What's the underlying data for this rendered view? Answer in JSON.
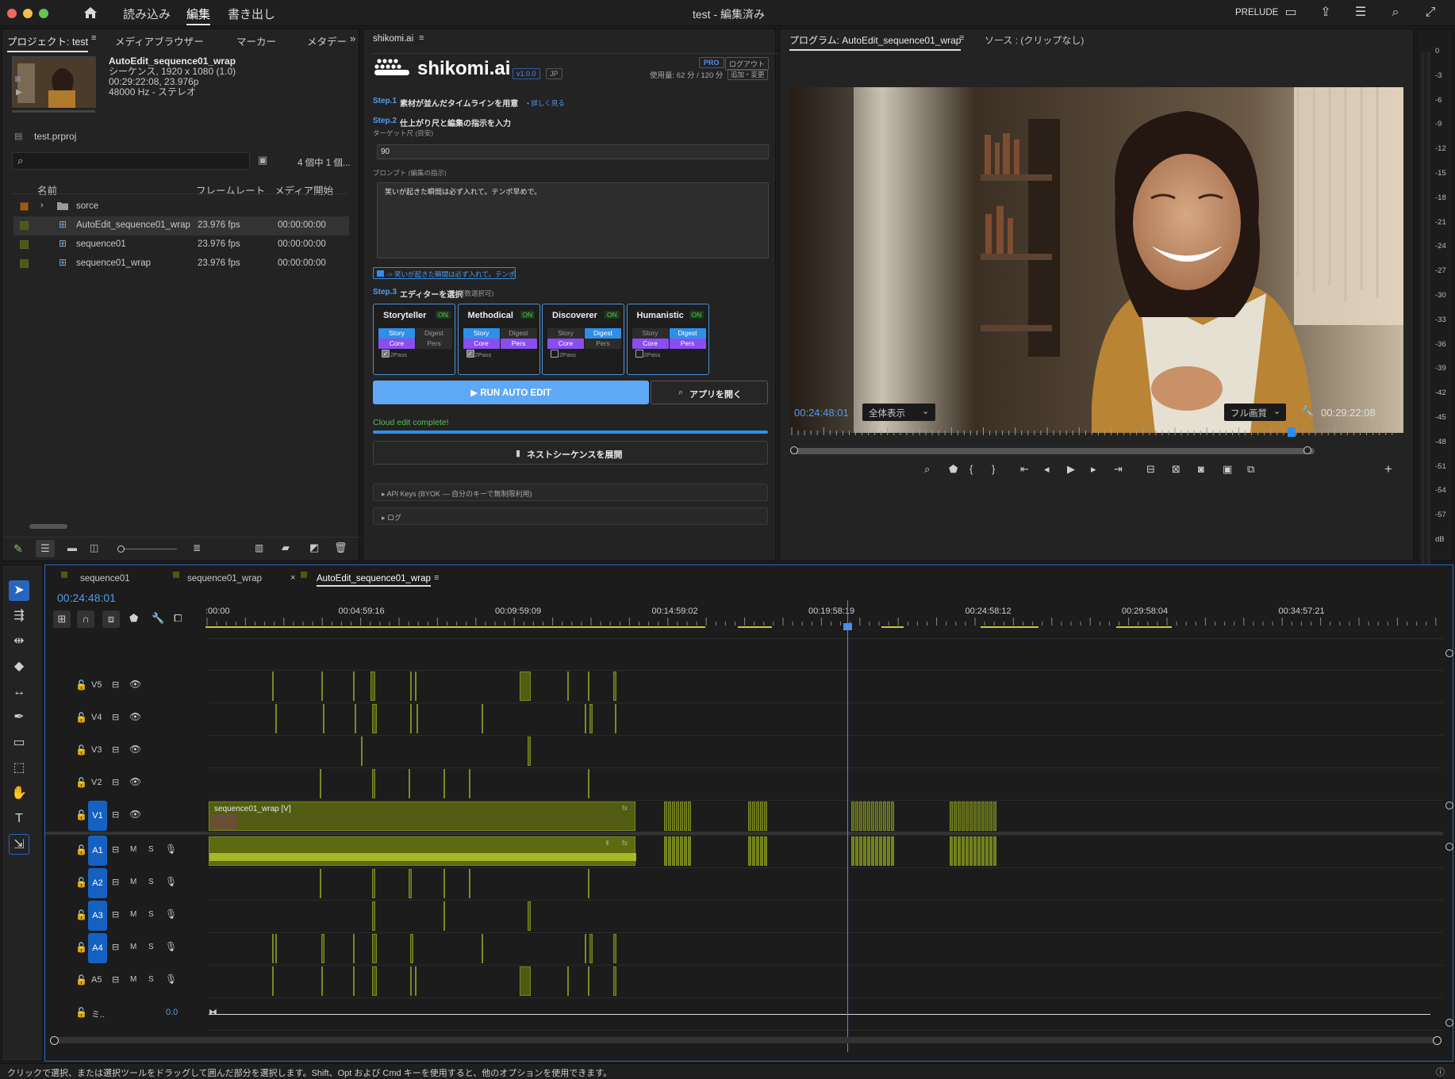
{
  "window": {
    "title": "test - 編集済み",
    "nav": [
      "読み込み",
      "編集",
      "書き出し"
    ],
    "active_nav": "編集",
    "prelude_label": "PRELUDE"
  },
  "project_panel": {
    "tabs": [
      "プロジェクト: test",
      "メディアブラウザー",
      "マーカー",
      "メタデー"
    ],
    "clip_name": "AutoEdit_sequence01_wrap",
    "clip_info": [
      "シーケンス, 1920 x 1080 (1.0)",
      "00:29:22:08, 23.976p",
      "48000 Hz - ステレオ"
    ],
    "project_file": "test.prproj",
    "item_count": "4 個中 1 個...",
    "columns": [
      "名前",
      "フレームレート",
      "メディア開始"
    ],
    "items": [
      {
        "name": "sorce",
        "fps": "",
        "start": "",
        "type": "folder"
      },
      {
        "name": "AutoEdit_sequence01_wrap",
        "fps": "23.976 fps",
        "start": "00:00:00:00",
        "type": "sequence"
      },
      {
        "name": "sequence01",
        "fps": "23.976 fps",
        "start": "00:00:00:00",
        "type": "sequence"
      },
      {
        "name": "sequence01_wrap",
        "fps": "23.976 fps",
        "start": "00:00:00:00",
        "type": "sequence"
      }
    ]
  },
  "shikomi": {
    "tab": "shikomi.ai",
    "logo": "shikomi.ai",
    "version": "v1.0.0",
    "lang": "JP",
    "plan": "PRO",
    "logout": "ログアウト",
    "usage": "使用量: 62 分 / 120 分",
    "usage_btn": "追加・変更",
    "step1_label": "Step.1",
    "step1_text": "素材が並んだタイムラインを用意",
    "step1_link": "• 詳しく見る",
    "step2_label": "Step.2",
    "step2_text": "仕上がり尺と編集の指示を入力",
    "target_label": "ターゲット尺 (目安)",
    "target_value": "90",
    "prompt_label": "プロンプト (編集の指示)",
    "prompt_value": "笑いが起きた瞬間は必ず入れて。テンポ早めで。",
    "preset_chip": "-> 笑いが起きた瞬間は必ず入れて。テンポ",
    "step3_label": "Step.3",
    "step3_text": "エディターを選択",
    "step3_note": "(複数選択可)",
    "editors": [
      {
        "name": "Storyteller",
        "on": "ON",
        "story": true,
        "digest": false,
        "core": true,
        "pers": false,
        "twopass": true
      },
      {
        "name": "Methodical",
        "on": "ON",
        "story": true,
        "digest": false,
        "core": true,
        "pers": true,
        "twopass": true
      },
      {
        "name": "Discoverer",
        "on": "ON",
        "story": false,
        "digest": true,
        "core": true,
        "pers": false,
        "twopass": false
      },
      {
        "name": "Humanistic",
        "on": "ON",
        "story": false,
        "digest": true,
        "core": true,
        "pers": true,
        "twopass": false
      }
    ],
    "pill_labels": {
      "story": "Story",
      "digest": "Digest",
      "core": "Core",
      "pers": "Pers",
      "twopass": "2Pass"
    },
    "run_button": "▶ RUN AUTO EDIT",
    "open_app_button": "アプリを開く",
    "status": "Cloud edit complete!",
    "progress": 1.0,
    "expand_button": "ネストシーケンスを展開",
    "api_keys": "▸ API Keys (BYOK — 自分のキーで無制限利用)",
    "log": "▸ ログ"
  },
  "program_monitor": {
    "tabs": [
      "プログラム: AutoEdit_sequence01_wrap",
      "ソース : (クリップなし)"
    ],
    "timecode": "00:24:48:01",
    "zoom": "全体表示",
    "quality": "フル画質",
    "duration": "00:29:22:08",
    "playhead_fraction": 0.845
  },
  "audio_meter": {
    "labels": [
      "0",
      "-3",
      "-6",
      "-9",
      "-12",
      "-15",
      "-18",
      "-21",
      "-24",
      "-27",
      "-30",
      "-33",
      "-36",
      "-39",
      "-42",
      "-45",
      "-48",
      "-51",
      "-54",
      "-57",
      "dB"
    ]
  },
  "timeline": {
    "tabs": [
      "sequence01",
      "sequence01_wrap",
      "AutoEdit_sequence01_wrap"
    ],
    "active_tab": "AutoEdit_sequence01_wrap",
    "timecode": "00:24:48:01",
    "ruler": [
      ":00:00",
      "00:04:59:16",
      "00:09:59:09",
      "00:14:59:02",
      "00:19:58:19",
      "00:24:58:12",
      "00:29:58:04",
      "00:34:57:21"
    ],
    "video_tracks": [
      "V5",
      "V4",
      "V3",
      "V2",
      "V1"
    ],
    "audio_tracks": [
      "A1",
      "A2",
      "A3",
      "A4",
      "A5"
    ],
    "mix_label": "ミ..",
    "mix_value": "0.0",
    "v1_clip_label": "sequence01_wrap [V]",
    "track_m": "M",
    "track_s": "S"
  },
  "status_bar": "クリックで選択、または選択ツールをドラッグして囲んだ部分を選択します。Shift、Opt および Cmd キーを使用すると、他のオプションを使用できます。",
  "colors": {
    "accent": "#2e8fe8",
    "clip": "#525c12",
    "clip_border": "#7c8a23",
    "track_badge": "#1561c2",
    "purple": "#8a4df0"
  }
}
